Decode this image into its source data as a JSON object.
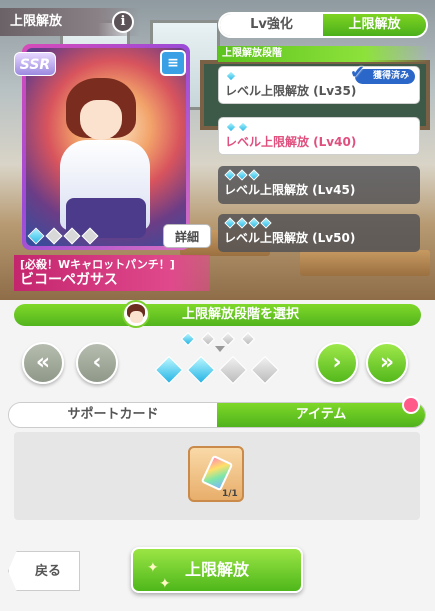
{
  "header": {
    "title": "上限解放",
    "info_label": "i"
  },
  "card": {
    "rarity": "SSR",
    "title": "[必殺！Wキャロットパンチ！]",
    "name": "ビコーペガサス",
    "detail_label": "詳細",
    "type_icon": "speed-type-icon",
    "stage_marks": [
      true,
      false,
      false,
      false
    ]
  },
  "tabs": {
    "lv": "Lv強化",
    "limit": "上限解放"
  },
  "stage_section": {
    "label": "上限解放段階",
    "rows": [
      {
        "label": "レベル上限解放 (Lv35)",
        "diamonds": 1,
        "obtained": "獲得済み"
      },
      {
        "label": "レベル上限解放 (Lv40)",
        "diamonds": 2
      },
      {
        "label": "レベル上限解放 (Lv45)",
        "diamonds": 3
      },
      {
        "label": "レベル上限解放 (Lv50)",
        "diamonds": 4
      }
    ]
  },
  "select_bar": {
    "label": "上限解放段階を選択"
  },
  "selector": {
    "current_stage": 2,
    "total_stages": 4
  },
  "segment": {
    "support": "サポートカード",
    "item": "アイテム"
  },
  "items": [
    {
      "name": "rainbow-crystal-item",
      "count": "1/1"
    }
  ],
  "footer": {
    "back": "戻る",
    "confirm": "上限解放"
  },
  "colors": {
    "accent_green": "#5cbf1f",
    "pink": "#e0507f",
    "obtained_blue": "#2b67c8"
  }
}
